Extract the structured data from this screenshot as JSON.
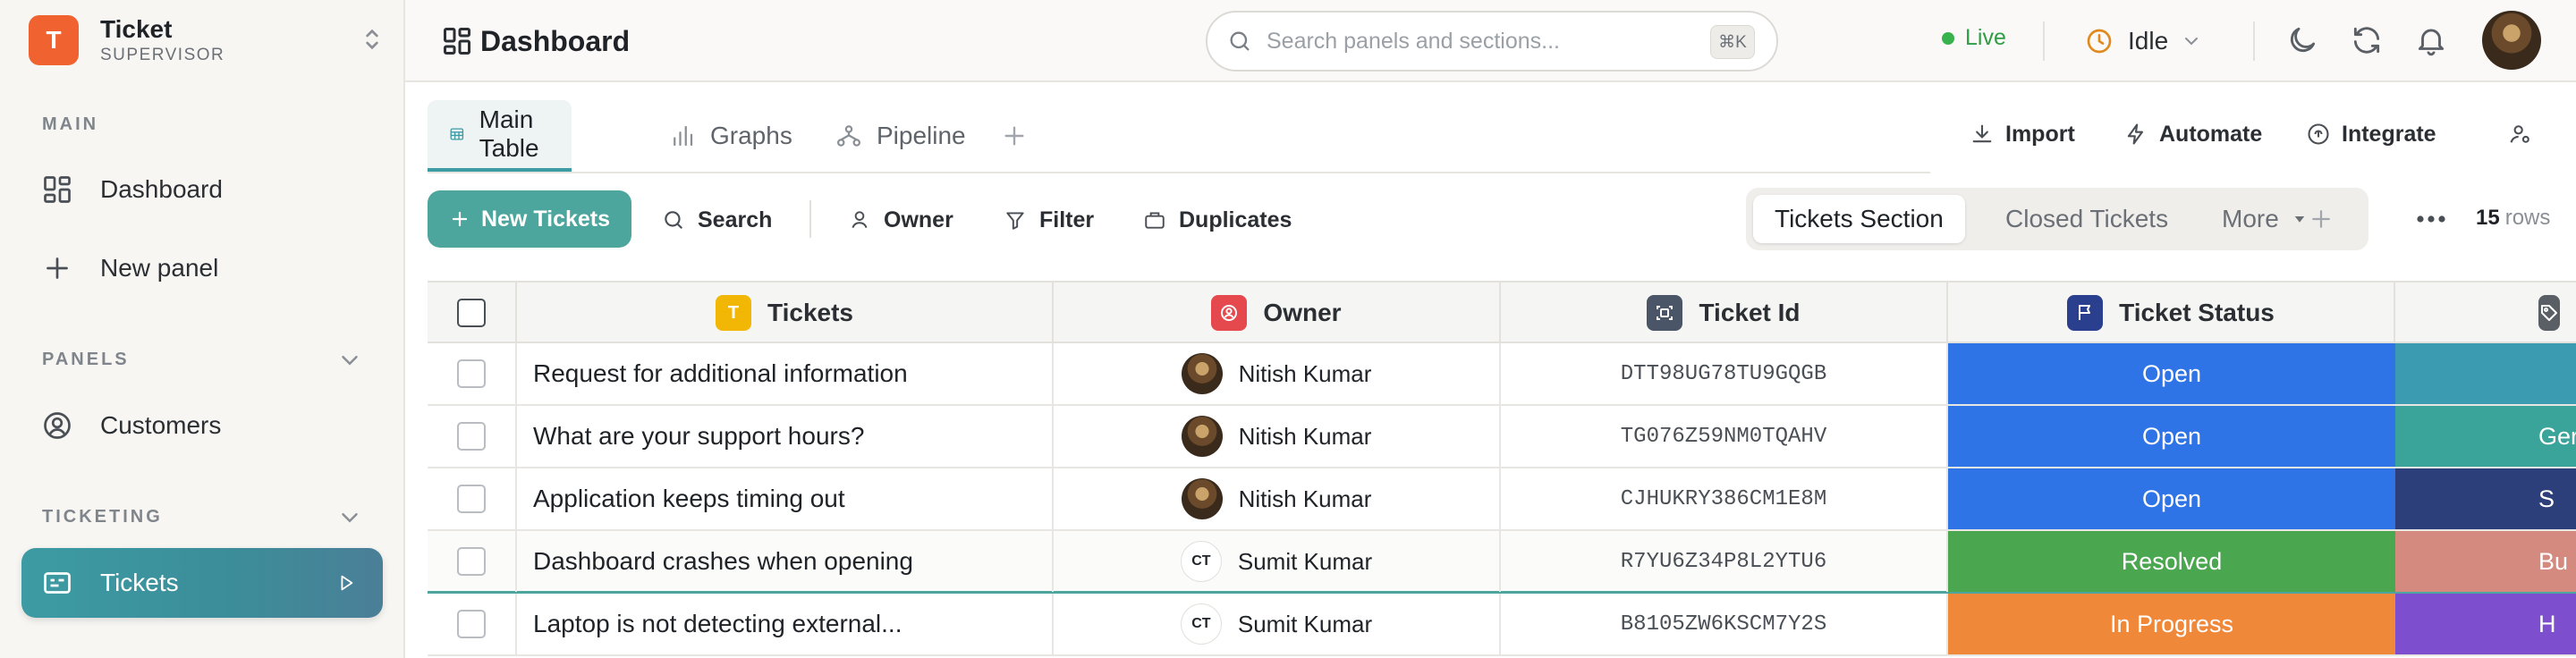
{
  "brand": {
    "initial": "T",
    "name": "Ticket",
    "subtitle": "SUPERVISOR"
  },
  "sidebar": {
    "main_label": "MAIN",
    "main_items": [
      {
        "label": "Dashboard",
        "icon": "dashboard-grid-icon"
      },
      {
        "label": "New panel",
        "icon": "plus-icon"
      }
    ],
    "panels_label": "PANELS",
    "panels_items": [
      {
        "label": "Customers",
        "icon": "user-circle-icon"
      }
    ],
    "ticketing_label": "TICKETING",
    "ticketing_items": [
      {
        "label": "Tickets",
        "icon": "ticket-table-icon",
        "active": true
      }
    ]
  },
  "header": {
    "title": "Dashboard",
    "search_placeholder": "Search panels and sections...",
    "search_shortcut": "⌘K",
    "live_label": "Live",
    "status_label": "Idle"
  },
  "tabs": [
    {
      "label": "Main Table",
      "icon": "table-icon",
      "active": true
    },
    {
      "label": "Graphs",
      "icon": "bar-chart-icon",
      "active": false
    },
    {
      "label": "Pipeline",
      "icon": "pipeline-icon",
      "active": false
    }
  ],
  "actions": {
    "import": "Import",
    "automate": "Automate",
    "integrate": "Integrate"
  },
  "toolbar": {
    "new_button": "New Tickets",
    "search": "Search",
    "owner": "Owner",
    "filter": "Filter",
    "duplicates": "Duplicates"
  },
  "sections": {
    "active": "Tickets Section",
    "other": "Closed Tickets",
    "more": "More"
  },
  "row_count": {
    "value": "15",
    "label": "rows"
  },
  "table": {
    "columns": [
      {
        "label": "Tickets",
        "icon_letter": "T",
        "color": "#f2b705"
      },
      {
        "label": "Owner",
        "color": "#e5484d"
      },
      {
        "label": "Ticket Id",
        "color": "#4a5568"
      },
      {
        "label": "Ticket Status",
        "color": "#2b3f8f"
      },
      {
        "label": "",
        "color": "#5a5f66"
      }
    ],
    "rows": [
      {
        "title": "Request for additional information",
        "owner": "Nitish Kumar",
        "owner_avatar": "photo",
        "id": "DTT98UG78TU9GQGB",
        "status": "Open",
        "status_color": "#2f74e6",
        "category": "",
        "category_color": "#3b9bb0"
      },
      {
        "title": "What are your support hours?",
        "owner": "Nitish Kumar",
        "owner_avatar": "photo",
        "id": "TG076Z59NM0TQAHV",
        "status": "Open",
        "status_color": "#2f74e6",
        "category": "Ger",
        "category_color": "#3aa39a"
      },
      {
        "title": "Application keeps timing out",
        "owner": "Nitish Kumar",
        "owner_avatar": "photo",
        "id": "CJHUKRY386CM1E8M",
        "status": "Open",
        "status_color": "#2f74e6",
        "category": "S",
        "category_color": "#2d3f7a"
      },
      {
        "title": "Dashboard crashes when opening",
        "owner": "Sumit Kumar",
        "owner_avatar": "CT",
        "id": "R7YU6Z34P8L2YTU6",
        "status": "Resolved",
        "status_color": "#4ba650",
        "category": "Bu",
        "category_color": "#d48a7e"
      },
      {
        "title": "Laptop is not detecting external...",
        "owner": "Sumit Kumar",
        "owner_avatar": "CT",
        "id": "B8105ZW6KSCM7Y2S",
        "status": "In Progress",
        "status_color": "#f0883a",
        "category": "H",
        "category_color": "#7d4fcf"
      }
    ]
  },
  "colors": {
    "accent": "#4ca69d",
    "brand": "#f0622f",
    "live": "#37b24d",
    "idle": "#e08a1e"
  }
}
